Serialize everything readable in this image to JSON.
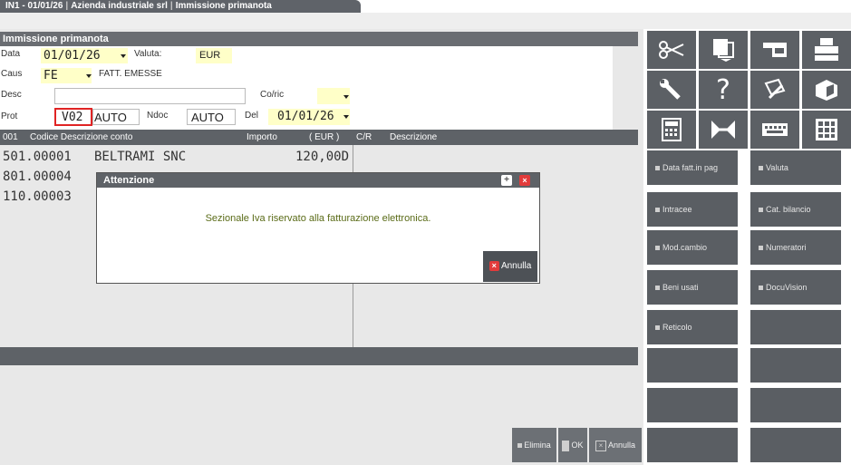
{
  "tab": {
    "code": "IN1 - 01/01/26",
    "company": "Azienda industriale srl",
    "module": "Immissione primanota"
  },
  "header": {
    "title": "Immissione primanota"
  },
  "form": {
    "data_label": "Data",
    "data_value": "01/01/26",
    "valuta_label": "Valuta:",
    "valuta_value": "EUR",
    "caus_label": "Caus",
    "caus_value": "FE",
    "caus_desc": "FATT. EMESSE",
    "desc_label": "Desc",
    "desc_value": "",
    "coric_label": "Co/ric",
    "coric_value": "",
    "prot_label": "Prot",
    "prot_value": "V02",
    "prot_auto": "AUTO",
    "ndoc_label": "Ndoc",
    "ndoc_value": "AUTO",
    "del_label": "Del",
    "del_value": "01/01/26"
  },
  "columns": {
    "num": "001",
    "codice": "Codice Descrizione conto",
    "importo": "Importo",
    "currency": "( EUR )",
    "cr": "C/R",
    "descrizione": "Descrizione"
  },
  "rows": [
    {
      "code": "501.00001",
      "name": "BELTRAMI SNC",
      "amount": "120,00D"
    },
    {
      "code": "801.00004",
      "name": "",
      "amount": ""
    },
    {
      "code": "110.00003",
      "name": "",
      "amount": ""
    }
  ],
  "dialog": {
    "title": "Attenzione",
    "message": "Sezionale Iva riservato alla fatturazione elettronica.",
    "annulla_label": "Annulla"
  },
  "toolbar_icons": [
    "scissors-icon",
    "paste-icon",
    "eraser-icon",
    "printer-icon",
    "wrench-icon",
    "help-icon",
    "edit-icon",
    "archive-icon",
    "calculator-icon",
    "transfer-icon",
    "keyboard-icon",
    "grid-icon"
  ],
  "side_buttons": [
    {
      "label": "Data fatt.in pag"
    },
    {
      "label": "Valuta"
    },
    {
      "label": "Intracee"
    },
    {
      "label": "Cat. bilancio"
    },
    {
      "label": "Mod.cambio"
    },
    {
      "label": "Numeratori"
    },
    {
      "label": "Beni usati"
    },
    {
      "label": "DocuVision"
    },
    {
      "label": "Reticolo"
    }
  ],
  "bottom_buttons": {
    "elimina": "Elimina",
    "ok": "OK",
    "annulla": "Annulla"
  },
  "colors": {
    "dark_bar": "#5e6267",
    "accent_red": "#e23b3b",
    "message_green": "#5a6b17",
    "field_yellow": "#ffffc8"
  }
}
